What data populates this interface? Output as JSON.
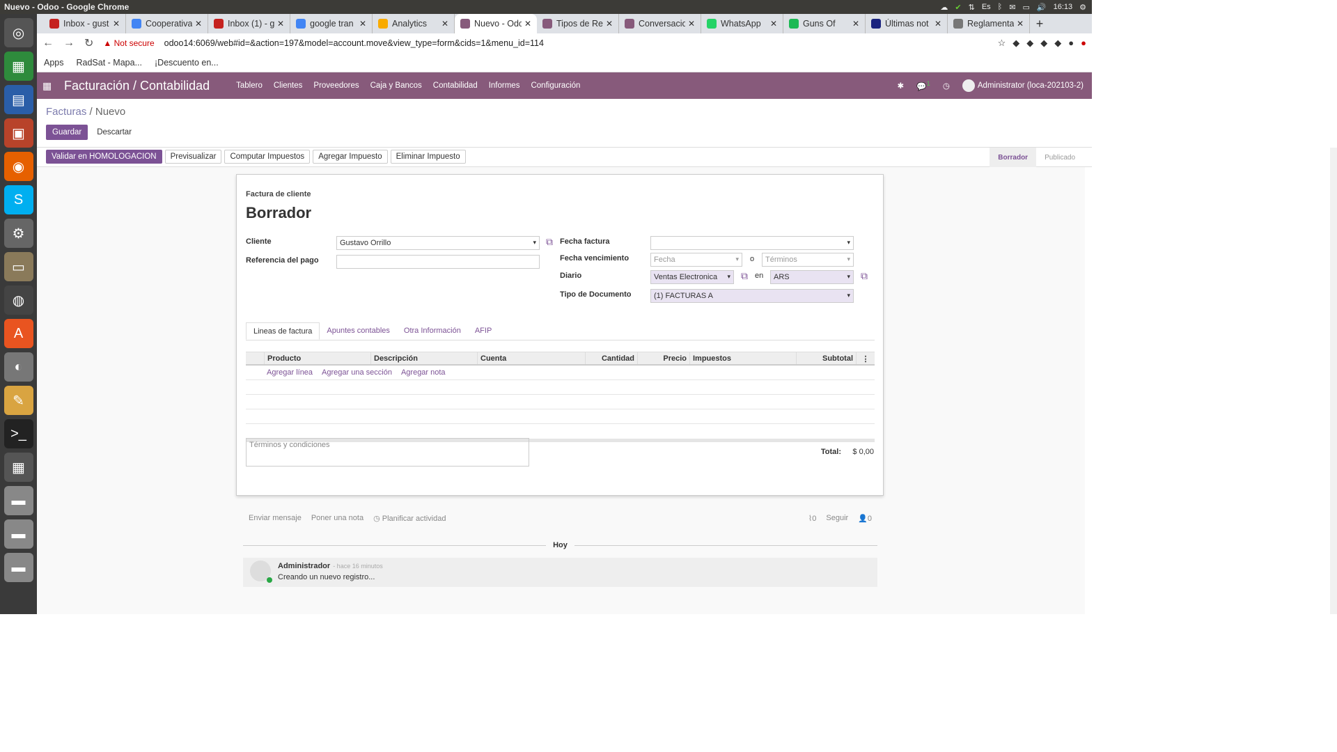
{
  "window": {
    "title": "Nuevo - Odoo - Google Chrome",
    "clock": "16:13",
    "lang": "Es"
  },
  "launcher": {
    "apps": [
      "ubuntu-icon",
      "spreadsheet-icon",
      "writer-icon",
      "impress-icon",
      "firefox-icon",
      "skype-icon",
      "settings-icon",
      "files-icon",
      "chrome-icon",
      "software-icon",
      "disk-icon",
      "notes-icon",
      "terminal-icon",
      "workspace-icon",
      "drive-icon",
      "drive-icon",
      "drive-icon",
      "trash-icon"
    ]
  },
  "browser": {
    "tabs": [
      {
        "label": "Inbox - gust",
        "color": "#c5221f"
      },
      {
        "label": "Cooperativa",
        "color": "#4285f4"
      },
      {
        "label": "Inbox (1) - g",
        "color": "#c5221f"
      },
      {
        "label": "google tran",
        "color": "#4285f4"
      },
      {
        "label": "Analytics",
        "color": "#f9ab00"
      },
      {
        "label": "Nuevo - Odo",
        "color": "#875a7b"
      },
      {
        "label": "Tipos de Re",
        "color": "#875a7b"
      },
      {
        "label": "Conversacio",
        "color": "#875a7b"
      },
      {
        "label": "WhatsApp",
        "color": "#25d366"
      },
      {
        "label": "Guns Of",
        "color": "#1db954"
      },
      {
        "label": "Últimas not",
        "color": "#1a237e"
      },
      {
        "label": "Reglamenta",
        "color": "#777777"
      }
    ],
    "security": "Not secure",
    "url": "odoo14:6069/web#id=&action=197&model=account.move&view_type=form&cids=1&menu_id=114",
    "bookmarks": [
      "Apps",
      "RadSat - Mapa...",
      "¡Descuento en..."
    ]
  },
  "odoo": {
    "app_title": "Facturación / Contabilidad",
    "menu": [
      "Tablero",
      "Clientes",
      "Proveedores",
      "Caja y Bancos",
      "Contabilidad",
      "Informes",
      "Configuración"
    ],
    "user": "Administrator (loca-202103-2)",
    "chat_count": "1"
  },
  "breadcrumb": {
    "parent": "Facturas",
    "current": "Nuevo"
  },
  "buttons": {
    "save": "Guardar",
    "discard": "Descartar"
  },
  "actions": [
    "Validar en HOMOLOGACION",
    "Previsualizar",
    "Computar Impuestos",
    "Agregar Impuesto",
    "Eliminar Impuesto"
  ],
  "stages": {
    "draft": "Borrador",
    "posted": "Publicado"
  },
  "form": {
    "doc_type": "Factura de cliente",
    "state": "Borrador",
    "cliente_label": "Cliente",
    "cliente_value": "Gustavo Orrillo",
    "ref_label": "Referencia del pago",
    "ref_value": "",
    "fecha_factura_label": "Fecha factura",
    "fecha_factura_value": "",
    "vencimiento_label": "Fecha vencimiento",
    "vencimiento_placeholder": "Fecha",
    "or": "o",
    "terminos_placeholder": "Términos",
    "diario_label": "Diario",
    "diario_value": "Ventas Electronica",
    "en": "en",
    "currency": "ARS",
    "tipo_doc_label": "Tipo de Documento",
    "tipo_doc_value": "(1) FACTURAS A"
  },
  "notebook": {
    "tabs": [
      "Lineas de factura",
      "Apuntes contables",
      "Otra Información",
      "AFIP"
    ]
  },
  "lines": {
    "columns": [
      "Producto",
      "Descripción",
      "Cuenta",
      "Cantidad",
      "Precio",
      "Impuestos",
      "Subtotal"
    ],
    "add_line": "Agregar línea",
    "add_section": "Agregar una sección",
    "add_note": "Agregar nota"
  },
  "totals": {
    "terms_placeholder": "Términos y condiciones",
    "total_label": "Total:",
    "total_value": "$ 0,00"
  },
  "chatter": {
    "send": "Enviar mensaje",
    "note": "Poner una nota",
    "activity": "Planificar actividad",
    "attachments": "0",
    "follow": "Seguir",
    "followers": "0",
    "today": "Hoy",
    "author": "Administrador",
    "time": "- hace 16 minutos",
    "body": "Creando un nuevo registro..."
  }
}
